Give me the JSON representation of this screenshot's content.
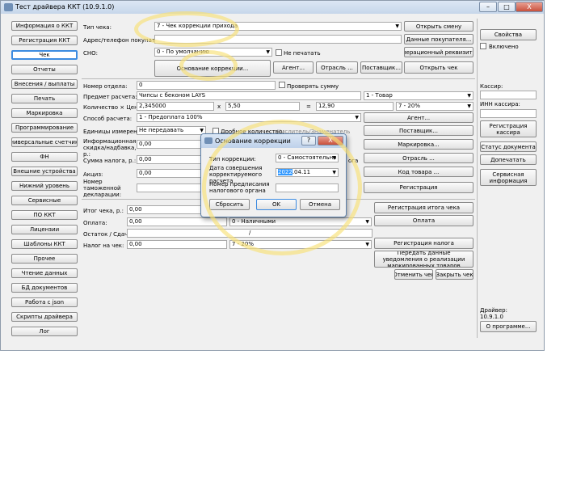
{
  "window": {
    "title": "Тест драйвера ККТ (10.9.1.0)",
    "min": "–",
    "max": "□",
    "close": "X"
  },
  "nav": [
    "Информация о ККТ",
    "Регистрация ККТ",
    "Чек",
    "Отчеты",
    "Внесения / выплаты",
    "Печать",
    "Маркировка",
    "Программирование",
    "Универсальные счетчики",
    "ФН",
    "Внешние устройства",
    "Нижний уровень",
    "Сервисные",
    "ПО ККТ",
    "Лицензии",
    "Шаблоны ККТ",
    "Прочее",
    "Чтение данных",
    "БД документов",
    "Работа с json",
    "Скрипты драйвера",
    "Лог"
  ],
  "form": {
    "receipt_type_label": "Тип чека:",
    "receipt_type_value": "7 - Чек коррекции прихода",
    "open_shift": "Открыть смену",
    "buyer_addr_label": "Адрес/телефон покупателя:",
    "buyer_data_btn": "Данные покупателя...",
    "sno_label": "СНО:",
    "sno_value": "0 - По умолчанию",
    "no_print": "Не печатать",
    "op_req_btn": "Операционный реквизит ...",
    "basis_btn": "Основание коррекции...",
    "agent_btn": "Агент...",
    "industry_btn": "Отрасль ...",
    "supplier_btn": "Поставщик...",
    "open_receipt_btn": "Открыть чек",
    "dept_label": "Номер отдела:",
    "dept_value": "0",
    "check_sum": "Проверять сумму",
    "item_label": "Предмет расчета:",
    "item_value": "Чипсы с беконом LAYS",
    "item_type": "1 - Товар",
    "qty_label": "Количество × Цена:",
    "qty_value": "2,345000",
    "x_sign": "x",
    "price_value": "5,50",
    "eq_sign": "=",
    "total_value": "12,90",
    "vat_value": "7 - 20%",
    "pay_method_label": "Способ расчета:",
    "pay_method_value": "1 - Предоплата 100%",
    "agent_btn2": "Агент...",
    "units_label": "Единицы измерения:",
    "units_value": "Не передавать",
    "fraction_qty": "Дробное количество:",
    "fraction_hint": "Числитель/Знаменатель",
    "supplier_btn2": "Поставщик...",
    "info_discount_label": "Информационная скидка/надбавка, р.:",
    "info_discount_value": "0,00",
    "marking_btn": "Маркировка...",
    "tax_sum_label": "Сумма налога, р.:",
    "tax_sum_value": "0,00",
    "tax_suffix": "ога",
    "industry_btn2": "Отрасль ...",
    "excise_label": "Акциз:",
    "excise_value": "0,00",
    "goods_code_btn": "Код товара ...",
    "customs_label": "Номер таможенной декларации:",
    "register_btn": "Регистрация",
    "receipt_total_label": "Итог чека, р.:",
    "receipt_total_value": "0,00",
    "reg_total_btn": "Регистрация итога чека",
    "payment_label": "Оплата:",
    "payment_value": "0,00",
    "payment_type": "0 - Наличными",
    "payment_btn": "Оплата",
    "change_label": "Остаток / Сдача:",
    "change_sep": "/",
    "tax_on_receipt_label": "Налог на чек:",
    "tax_on_receipt_value": "0,00",
    "tax_on_receipt_type": "7 - 20%",
    "reg_tax_btn": "Регистрация налога",
    "send_marking_btn": "Передать данные уведомления о реализации маркированных товаров",
    "cancel_receipt_btn": "Отменить чек",
    "close_receipt_btn": "Закрыть чек"
  },
  "right": {
    "props_btn": "Свойства",
    "enabled": "Включено",
    "cashier_label": "Кассир:",
    "inn_label": "ИНН кассира:",
    "reg_cashier_btn": "Регистрация кассира",
    "doc_status_btn": "Статус документа",
    "reprint_btn": "Допечатать",
    "service_info_btn": "Сервисная информация",
    "driver_label": "Драйвер:",
    "driver_version": "10.9.1.0",
    "about_btn": "О программе..."
  },
  "dialog": {
    "title": "Основание коррекции",
    "help": "?",
    "close": "X",
    "corr_type_label": "Тип коррекции:",
    "corr_type_value": "0 - Самостоятельно",
    "date_label": "Дата совершения корректируемого расчета",
    "date_sel": "2022",
    "date_rest": ".04.11",
    "order_label": "Номер предписания налогового органа",
    "reset_btn": "Сбросить",
    "ok_btn": "OK",
    "cancel_btn": "Отмена"
  }
}
